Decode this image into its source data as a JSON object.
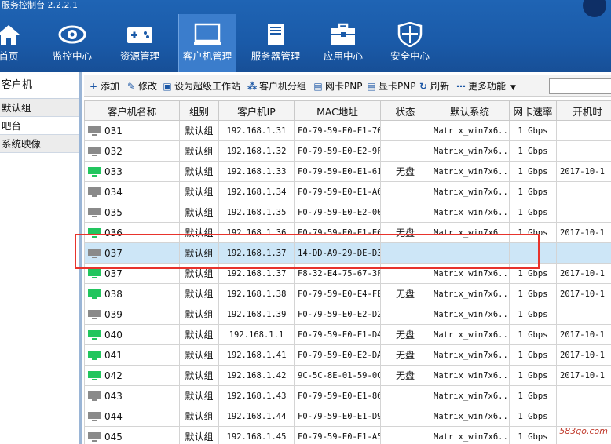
{
  "app": {
    "title": "服务控制台 2.2.2.1"
  },
  "nav": [
    {
      "label": "首页",
      "icon": "home-icon"
    },
    {
      "label": "监控中心",
      "icon": "eye-icon"
    },
    {
      "label": "资源管理",
      "icon": "gamepad-icon"
    },
    {
      "label": "客户机管理",
      "icon": "monitor-icon",
      "active": true
    },
    {
      "label": "服务器管理",
      "icon": "server-icon"
    },
    {
      "label": "应用中心",
      "icon": "toolbox-icon"
    },
    {
      "label": "安全中心",
      "icon": "shield-icon"
    }
  ],
  "sidebar": {
    "title": "客户机",
    "items": [
      {
        "label": "默认组"
      },
      {
        "label": "吧台"
      },
      {
        "label": "系统映像"
      }
    ]
  },
  "toolbar": {
    "add": "添加",
    "edit": "修改",
    "set_super": "设为超级工作站",
    "group": "客户机分组",
    "nic_pnp": "网卡PNP",
    "gpu_pnp": "显卡PNP",
    "refresh": "刷新",
    "more": "更多功能"
  },
  "table": {
    "columns": [
      "客户机名称",
      "组别",
      "客户机IP",
      "MAC地址",
      "状态",
      "默认系统",
      "网卡速率",
      "开机时"
    ],
    "rows": [
      {
        "name": "031",
        "group": "默认组",
        "ip": "192.168.1.31",
        "mac": "F0-79-59-E0-E1-70",
        "status": "",
        "os": "Matrix_win7x6...",
        "speed": "1 Gbps",
        "boot": "",
        "online": false
      },
      {
        "name": "032",
        "group": "默认组",
        "ip": "192.168.1.32",
        "mac": "F0-79-59-E0-E2-9F",
        "status": "",
        "os": "Matrix_win7x6...",
        "speed": "1 Gbps",
        "boot": "",
        "online": false
      },
      {
        "name": "033",
        "group": "默认组",
        "ip": "192.168.1.33",
        "mac": "F0-79-59-E0-E1-61",
        "status": "无盘",
        "os": "Matrix_win7x6...",
        "speed": "1 Gbps",
        "boot": "2017-10-1",
        "online": true
      },
      {
        "name": "034",
        "group": "默认组",
        "ip": "192.168.1.34",
        "mac": "F0-79-59-E0-E1-A6",
        "status": "",
        "os": "Matrix_win7x6...",
        "speed": "1 Gbps",
        "boot": "",
        "online": false
      },
      {
        "name": "035",
        "group": "默认组",
        "ip": "192.168.1.35",
        "mac": "F0-79-59-E0-E2-00",
        "status": "",
        "os": "Matrix_win7x6...",
        "speed": "1 Gbps",
        "boot": "",
        "online": false
      },
      {
        "name": "036",
        "group": "默认组",
        "ip": "192.168.1.36",
        "mac": "F0-79-59-E0-E1-E6",
        "status": "无盘",
        "os": "Matrix_win7x6...",
        "speed": "1 Gbps",
        "boot": "2017-10-1",
        "online": true
      },
      {
        "name": "037",
        "group": "默认组",
        "ip": "192.168.1.37",
        "mac": "14-DD-A9-29-DE-D3",
        "status": "",
        "os": "",
        "speed": "",
        "boot": "",
        "online": false,
        "selected": true
      },
      {
        "name": "037",
        "group": "默认组",
        "ip": "192.168.1.37",
        "mac": "F8-32-E4-75-67-3F",
        "status": "",
        "os": "Matrix_win7x6...",
        "speed": "1 Gbps",
        "boot": "2017-10-1",
        "online": true
      },
      {
        "name": "038",
        "group": "默认组",
        "ip": "192.168.1.38",
        "mac": "F0-79-59-E0-E4-FE",
        "status": "无盘",
        "os": "Matrix_win7x6...",
        "speed": "1 Gbps",
        "boot": "2017-10-1",
        "online": true
      },
      {
        "name": "039",
        "group": "默认组",
        "ip": "192.168.1.39",
        "mac": "F0-79-59-E0-E2-D2",
        "status": "",
        "os": "Matrix_win7x6...",
        "speed": "1 Gbps",
        "boot": "",
        "online": false
      },
      {
        "name": "040",
        "group": "默认组",
        "ip": "192.168.1.1",
        "mac": "F0-79-59-E0-E1-D4",
        "status": "无盘",
        "os": "Matrix_win7x6...",
        "speed": "1 Gbps",
        "boot": "2017-10-1",
        "online": true
      },
      {
        "name": "041",
        "group": "默认组",
        "ip": "192.168.1.41",
        "mac": "F0-79-59-E0-E2-DA",
        "status": "无盘",
        "os": "Matrix_win7x6...",
        "speed": "1 Gbps",
        "boot": "2017-10-1",
        "online": true
      },
      {
        "name": "042",
        "group": "默认组",
        "ip": "192.168.1.42",
        "mac": "9C-5C-8E-01-59-0C",
        "status": "无盘",
        "os": "Matrix_win7x6...",
        "speed": "1 Gbps",
        "boot": "2017-10-1",
        "online": true
      },
      {
        "name": "043",
        "group": "默认组",
        "ip": "192.168.1.43",
        "mac": "F0-79-59-E0-E1-86",
        "status": "",
        "os": "Matrix_win7x6...",
        "speed": "1 Gbps",
        "boot": "",
        "online": false
      },
      {
        "name": "044",
        "group": "默认组",
        "ip": "192.168.1.44",
        "mac": "F0-79-59-E0-E1-D9",
        "status": "",
        "os": "Matrix_win7x6...",
        "speed": "1 Gbps",
        "boot": "",
        "online": false
      },
      {
        "name": "045",
        "group": "默认组",
        "ip": "192.168.1.45",
        "mac": "F0-79-59-E0-E1-A5",
        "status": "",
        "os": "Matrix_win7x6...",
        "speed": "1 Gbps",
        "boot": "",
        "online": false
      }
    ]
  },
  "colors": {
    "online": "#22c55e",
    "offline": "#8a8a8a",
    "accent": "#1a5aa8",
    "highlight": "#e8332c"
  },
  "watermark": "583go.com"
}
